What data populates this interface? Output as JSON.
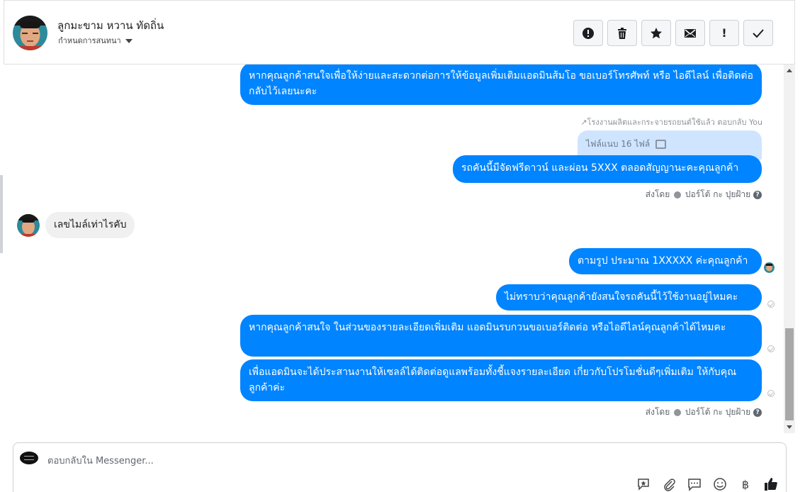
{
  "header": {
    "name": "ลูกมะขาม หวาน ทัดถิ่น",
    "subtitle": "กำหนดการสนทนา",
    "toolbar": [
      {
        "name": "spam-button",
        "icon": "alert-circle-icon"
      },
      {
        "name": "delete-button",
        "icon": "trash-icon"
      },
      {
        "name": "star-button",
        "icon": "star-icon"
      },
      {
        "name": "mark-unread-button",
        "icon": "envelope-icon"
      },
      {
        "name": "important-button",
        "icon": "exclamation-icon",
        "label": "!"
      },
      {
        "name": "done-button",
        "icon": "checkmark-icon"
      }
    ]
  },
  "messages": {
    "m1": "หากคุณลูกค้าสนใจเพื่อให้ง่ายและสะดวกต่อการให้ข้อมูลเพิ่มเติมแอดมินส้มโอ ขอเบอร์โทรศัพท์ หรือ ไอดีไลน์ เพื่อติดต่อกลับไว้เลยนะคะ",
    "reply_note": "โรงงานผลิตและกระจายรถยนต์ใช้แล้ว ตอบกลับ You",
    "attachment": "ไฟล์แนบ 16 ไฟล์",
    "m2": "รถคันนี้มีจัดฟรีดาวน์ และผ่อน 5XXX ตลอดสัญญานะคะคุณลูกค้า",
    "sent_by_1": "ส่งโดย",
    "sender_1": "ปอร์โต้ กะ ปุยฝ้าย",
    "incoming": "เลขไมล์เท่าไรคับ",
    "m3": "ตามรูป ประมาณ 1XXXXX ค่ะคุณลูกค้า",
    "m4": "ไม่ทราบว่าคุณลูกค้ายังสนใจรถคันนี้ไว้ใช้งานอยู่ไหมคะ",
    "m5": "หากคุณลูกค้าสนใจ ในส่วนของรายละเอียดเพิ่มเติม แอดมินรบกวนขอเบอร์ติดต่อ หรือไอดีไลน์คุณลูกค้าได้ไหมคะ",
    "m6": "เพื่อแอดมินจะได้ประสานงานให้เซลล์ได้ติดต่อดูแลพร้อมทั้งชี้แจงรายละเอียด เกี่ยวกับโปรโมชั่นดีๆเพิ่มเติม ให้กับคุณลูกค้าค่ะ",
    "sent_by_2": "ส่งโดย",
    "sender_2": "ปอร์โต้ กะ ปุยฝ้าย"
  },
  "composer": {
    "placeholder": "ตอบกลับใน Messenger...",
    "tools": [
      "saved-reply-icon",
      "attachment-icon",
      "chat-bubble-icon",
      "emoji-icon",
      "baht-icon",
      "thumbs-up-icon"
    ],
    "baht": "฿"
  },
  "colors": {
    "outgoing_bubble": "#0084ff",
    "incoming_bubble": "#f1f0f0",
    "attachment_bubble": "#cfe4ff"
  }
}
